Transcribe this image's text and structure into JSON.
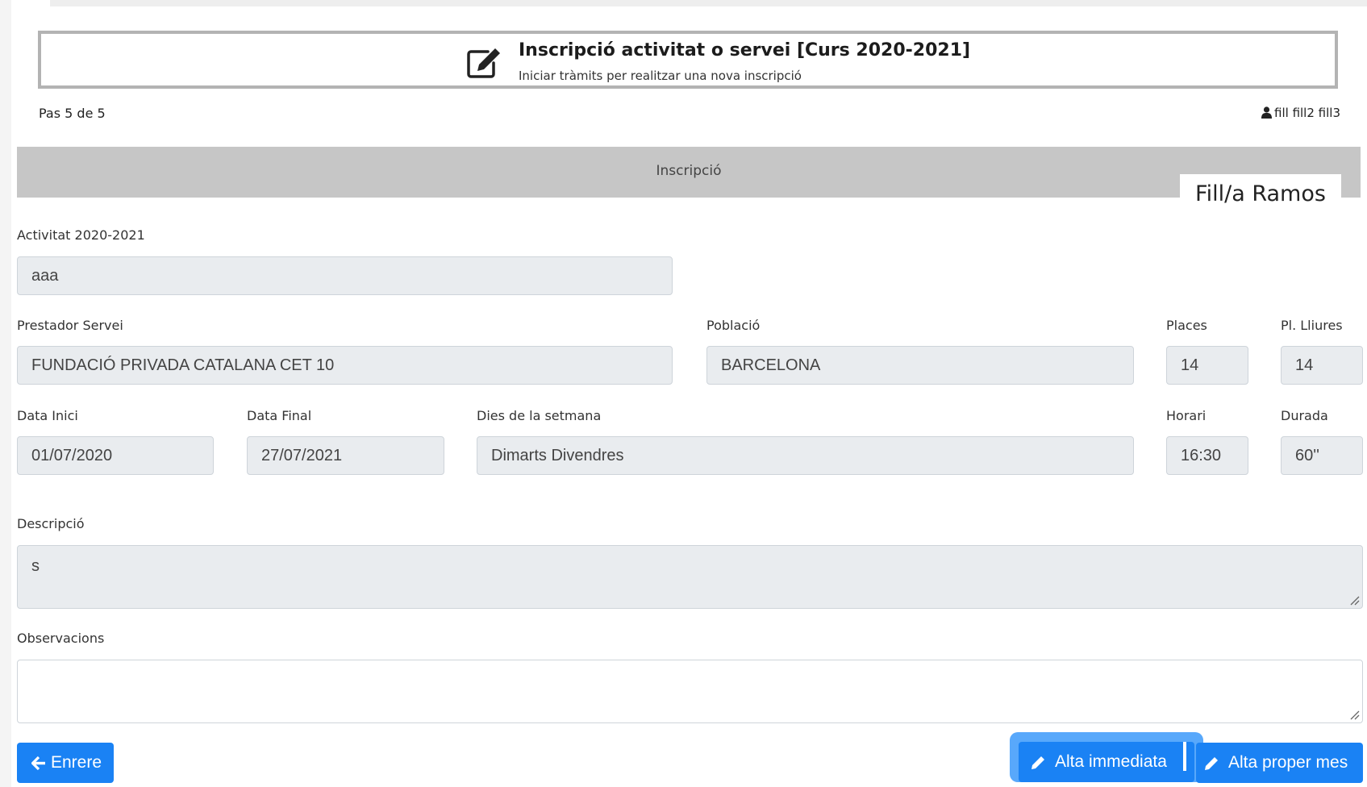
{
  "header": {
    "title": "Inscripció activitat o servei [Curs 2020-2021]",
    "subtitle": "Iniciar tràmits per realitzar una nova inscripció",
    "icon": "edit-icon"
  },
  "step_text": "Pas 5 de 5",
  "users": {
    "icon": "user-icon",
    "text": "fill fill2 fill3"
  },
  "section": {
    "title": "Inscripció",
    "child_tab": "Fill/a Ramos"
  },
  "form": {
    "activitat": {
      "label": "Activitat  2020-2021",
      "value": "aaa"
    },
    "prestador": {
      "label": "Prestador Servei",
      "value": "FUNDACIÓ PRIVADA CATALANA CET 10"
    },
    "poblacio": {
      "label": "Població",
      "value": "BARCELONA"
    },
    "places": {
      "label": "Places",
      "value": "14"
    },
    "pl_lliures": {
      "label": "Pl. Lliures",
      "value": "14"
    },
    "data_inici": {
      "label": "Data Inici",
      "value": "01/07/2020"
    },
    "data_final": {
      "label": "Data Final",
      "value": "27/07/2021"
    },
    "dies": {
      "label": "Dies de la setmana",
      "value": "Dimarts Divendres"
    },
    "horari": {
      "label": "Horari",
      "value": "16:30"
    },
    "durada": {
      "label": "Durada",
      "value": "60''"
    },
    "descripcio": {
      "label": "Descripció",
      "value": "s"
    },
    "observacions": {
      "label": "Observacions",
      "value": ""
    }
  },
  "buttons": {
    "back": {
      "label": "Enrere",
      "icon": "arrow-left-icon"
    },
    "alta_immediata": {
      "label": "Alta immediata",
      "icon": "pencil-icon"
    },
    "alta_proper_mes": {
      "label": "Alta proper mes",
      "icon": "pencil-icon"
    }
  },
  "colors": {
    "primary": "#1a82f4",
    "focus": "#58a8fb",
    "section_bar": "#c6c6c6",
    "readonly": "#e9ecef"
  }
}
